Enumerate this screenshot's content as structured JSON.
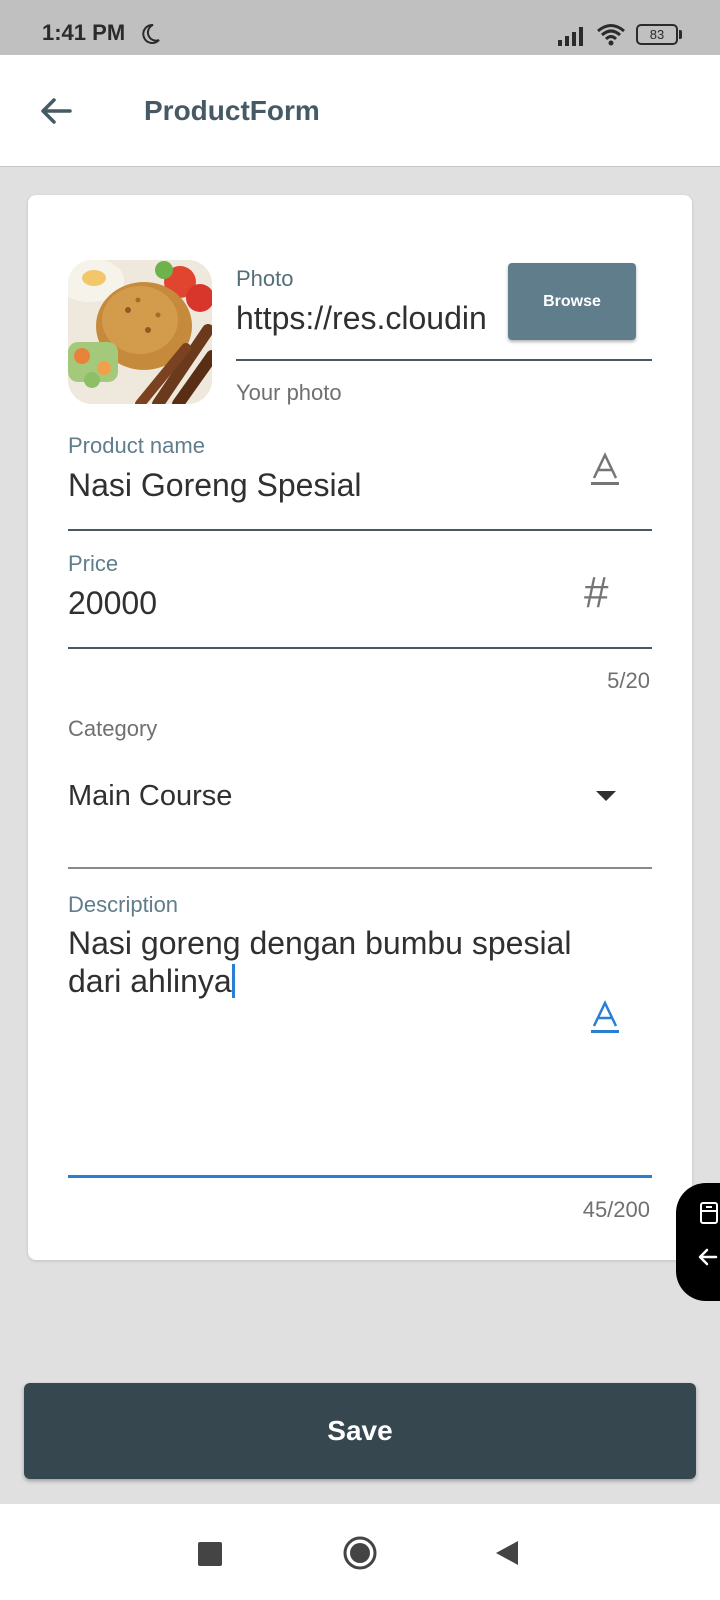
{
  "status_bar": {
    "time": "1:41 PM",
    "battery": "83"
  },
  "app_bar": {
    "title": "ProductForm"
  },
  "photo": {
    "label": "Photo",
    "value": "https://res.cloudin",
    "browse_label": "Browse",
    "helper": "Your photo"
  },
  "product_name": {
    "label": "Product name",
    "value": "Nasi Goreng Spesial"
  },
  "price": {
    "label": "Price",
    "value": "20000",
    "counter": "5/20"
  },
  "category": {
    "label": "Category",
    "selected": "Main Course"
  },
  "description": {
    "label": "Description",
    "line1": "Nasi goreng dengan bumbu spesial",
    "line2": "dari ahlinya",
    "counter": "45/200"
  },
  "save_label": "Save",
  "colors": {
    "primary": "#455a64",
    "accent_focus": "#2a7fd5",
    "save_button": "#37474f",
    "browse_button": "#607d8b"
  },
  "icons": [
    "back-arrow",
    "text-format",
    "hash",
    "dropdown-arrow",
    "clipboard",
    "arrow-left"
  ]
}
